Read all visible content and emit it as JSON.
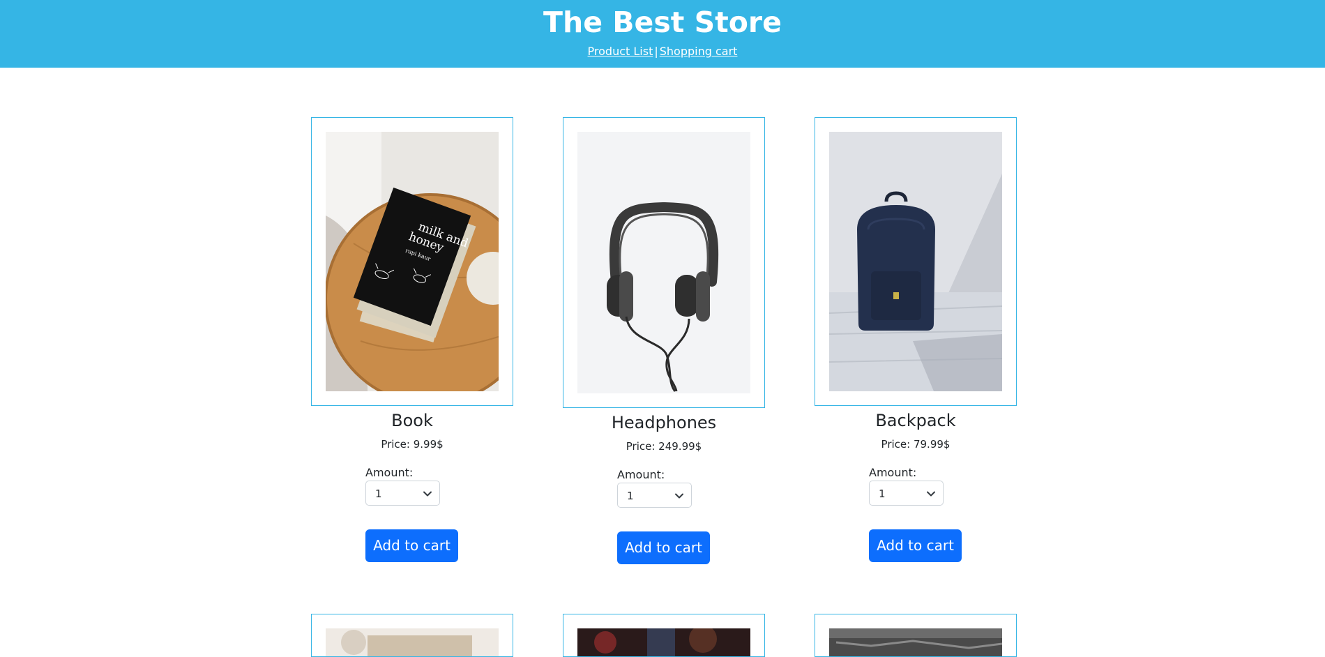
{
  "header": {
    "title": "The Best Store",
    "nav": {
      "product_list": "Product List",
      "separator": "|",
      "shopping_cart": "Shopping cart"
    }
  },
  "products": [
    {
      "name": "Book",
      "price": "Price: 9.99$",
      "amount_label": "Amount:",
      "amount": "1",
      "button": "Add to cart"
    },
    {
      "name": "Headphones",
      "price": "Price: 249.99$",
      "amount_label": "Amount:",
      "amount": "1",
      "button": "Add to cart"
    },
    {
      "name": "Backpack",
      "price": "Price: 79.99$",
      "amount_label": "Amount:",
      "amount": "1",
      "button": "Add to cart"
    }
  ],
  "colors": {
    "header": "#35b5e5",
    "button": "#0d6efd",
    "card_border": "#35b5e5"
  }
}
